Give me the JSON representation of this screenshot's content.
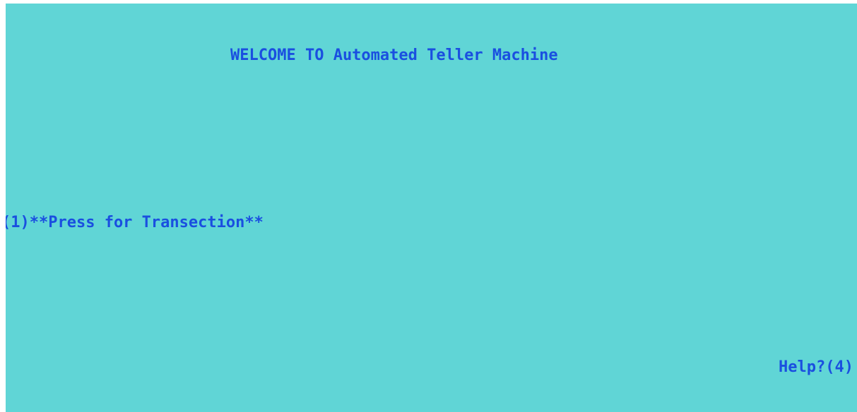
{
  "screen": {
    "background_color": "#60d5d6",
    "text_color": "#1a4fe0",
    "title": "WELCOME TO Automated Teller Machine",
    "options": {
      "transaction": "(1)**Press for Transection**",
      "help": "Help?(4)"
    }
  }
}
